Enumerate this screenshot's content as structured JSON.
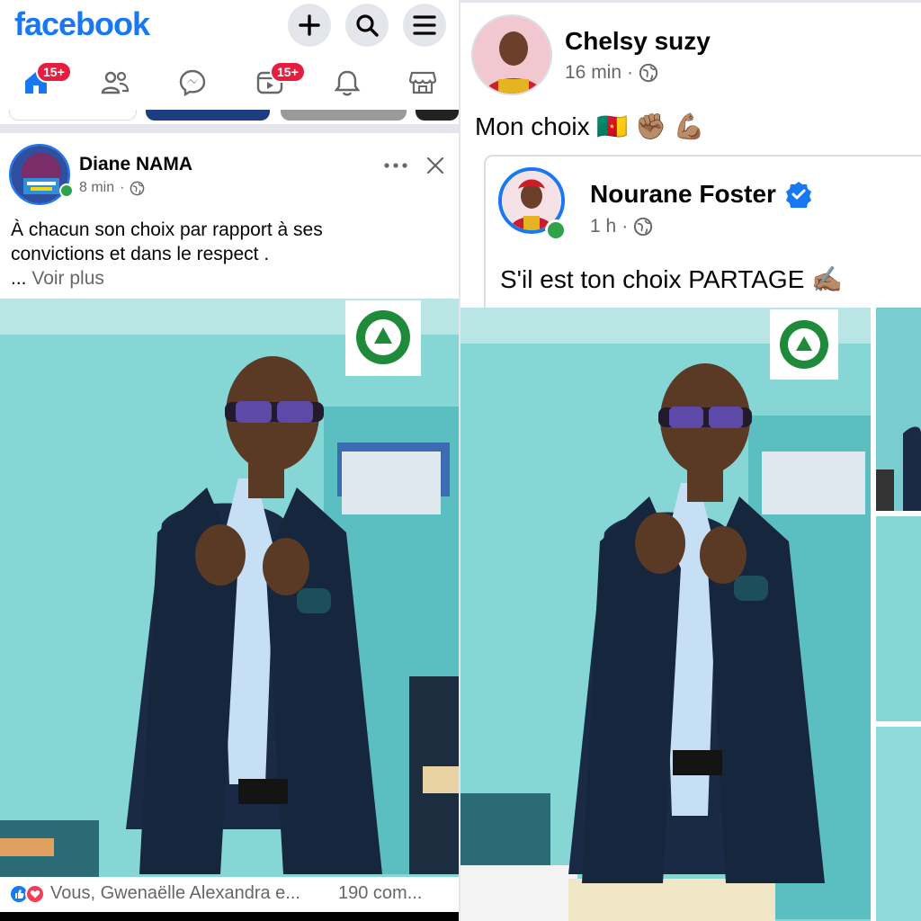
{
  "app": {
    "logo": "facebook",
    "badge_home": "15+",
    "badge_video": "15+",
    "brand_color": "#1877f2"
  },
  "left_post": {
    "author": "Diane NAMA",
    "time": "8 min",
    "text_line1": "À chacun son choix par rapport à ses",
    "text_line2": "convictions et dans le respect .",
    "see_more_prefix": "... ",
    "see_more": "Voir plus",
    "reactions_text": "Vous, Gwenaëlle Alexandra e...",
    "comments": "190 com..."
  },
  "right_post": {
    "author": "Chelsy suzy",
    "time": "16 min",
    "caption": "Mon choix 🇨🇲 ✊🏽 💪🏽",
    "shared": {
      "author": "Nourane Foster",
      "time": "1 h",
      "text": "S'il est ton choix PARTAGE ✍🏽"
    }
  },
  "icons": {
    "plus": "plus-icon",
    "search": "search-icon",
    "menu": "menu-icon",
    "home": "home-icon",
    "friends": "friends-icon",
    "messenger": "messenger-icon",
    "video": "video-icon",
    "notifications": "bell-icon",
    "marketplace": "marketplace-icon",
    "more": "more-icon",
    "close": "close-icon",
    "globe": "globe-icon",
    "verified": "verified-badge-icon"
  }
}
